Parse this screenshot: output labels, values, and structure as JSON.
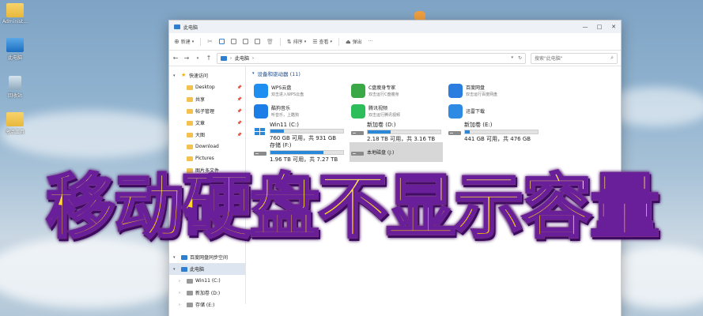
{
  "desktop": {
    "icons": [
      {
        "label": "Administ..."
      },
      {
        "label": "此电脑"
      },
      {
        "label": "回收站"
      },
      {
        "label": "激活工具"
      }
    ]
  },
  "window": {
    "title": "此电脑",
    "controls": {
      "minimize": "—",
      "maximize": "□",
      "close": "✕"
    },
    "toolbar": {
      "new_label": "新建",
      "sort_label": "排序",
      "view_label": "查看",
      "eject_label": "弹出",
      "more_label": "···"
    },
    "address": {
      "path_root": "此电脑",
      "search_placeholder": "搜索\"此电脑\""
    },
    "nav_pane": {
      "items": [
        {
          "label": "快速访问",
          "type": "star",
          "level": 0
        },
        {
          "label": "Desktop",
          "type": "folder",
          "level": 1,
          "pinned": true
        },
        {
          "label": "共享",
          "type": "folder",
          "level": 1,
          "pinned": true
        },
        {
          "label": "帖子管理",
          "type": "folder",
          "level": 1,
          "pinned": true
        },
        {
          "label": "文章",
          "type": "folder",
          "level": 1,
          "pinned": true
        },
        {
          "label": "大图",
          "type": "folder",
          "level": 1,
          "pinned": true
        },
        {
          "label": "Download",
          "type": "folder",
          "level": 1
        },
        {
          "label": "Pictures",
          "type": "folder",
          "level": 1
        },
        {
          "label": "图片多文件",
          "type": "folder",
          "level": 1
        }
      ],
      "bottom_items": [
        {
          "label": "百度网盘同步空间",
          "type": "blue",
          "level": 0
        },
        {
          "label": "此电脑",
          "type": "blue",
          "level": 0,
          "selected": true
        },
        {
          "label": "Win11 (C:)",
          "type": "gray",
          "level": 1
        },
        {
          "label": "新加卷 (D:)",
          "type": "gray",
          "level": 1
        },
        {
          "label": "存储 (E:)",
          "type": "gray",
          "level": 1
        }
      ]
    },
    "content": {
      "section_title": "设备和驱动器 (11)",
      "apps": [
        {
          "name": "WPS云盘",
          "sub": "双击进入WPS云盘",
          "color": "#1e8ff0"
        },
        {
          "name": "C盘瘦身专家",
          "sub": "双击运行C盘瘦身",
          "color": "#3aa847"
        },
        {
          "name": "百度网盘",
          "sub": "双击运行百度网盘",
          "color": "#2b7de0"
        },
        {
          "name": "酷狗音乐",
          "sub": "听音乐，上酷狗",
          "color": "#1a7ee6"
        },
        {
          "name": "腾讯视频",
          "sub": "双击运行腾讯视频",
          "color": "#2dbd5a"
        },
        {
          "name": "迅雷下载",
          "sub": "",
          "color": "#2f8ae3"
        }
      ],
      "drives": [
        {
          "name": "Win11 (C:)",
          "sub": "760 GB 可用，共 931 GB",
          "used": 0.18
        },
        {
          "name": "新加卷 (D:)",
          "sub": "2.18 TB 可用，共 3.16 TB",
          "used": 0.31
        },
        {
          "name": "新加卷 (E:)",
          "sub": "441 GB 可用，共 476 GB",
          "used": 0.07
        },
        {
          "name": "存储 (F:)",
          "sub": "1.96 TB 可用，共 7.27 TB",
          "used": 0.73
        },
        {
          "name": "本地磁盘 (J:)",
          "sub": "",
          "used": null
        }
      ]
    }
  },
  "banner": {
    "text": "移动硬盘不显示容量"
  },
  "colors": {
    "accent": "#2b88d8",
    "banner_fill": "#ffd31a",
    "banner_stroke": "#6a1f9a"
  }
}
